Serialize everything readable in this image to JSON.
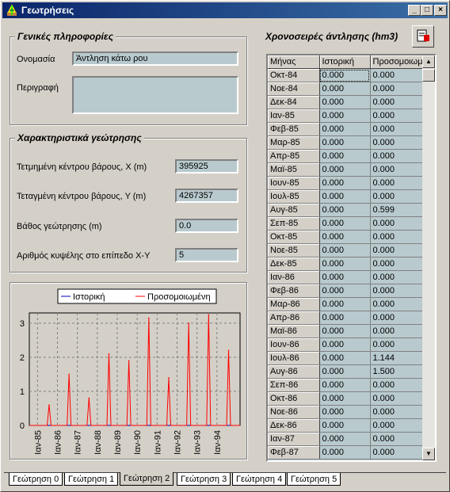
{
  "window": {
    "title": "Γεωτρήσεις",
    "minimize": "_",
    "maximize": "□",
    "close": "×"
  },
  "general": {
    "title": "Γενικές πληροφορίες",
    "name_label": "Ονομασία",
    "name_value": "Άντληση κάτω ρου",
    "description_label": "Περιγραφή",
    "description_value": ""
  },
  "characteristics": {
    "title": "Χαρακτηριστικά γεώτρησης",
    "x_label": "Τετμημένη κέντρου βάρους, X (m)",
    "x_value": "395925",
    "y_label": "Τεταγμένη κέντρου βάρους, Y (m)",
    "y_value": "4267357",
    "depth_label": "Βάθος γεώτρησης (m)",
    "depth_value": "0.0",
    "cell_label": "Αριθμός κυψέλης στο επίπεδο X-Y",
    "cell_value": "5"
  },
  "timeseries": {
    "title": "Χρονοσειρές άντλησης (hm3)",
    "columns": [
      "Μήνας",
      "Ιστορική",
      "Προσομοιωμ"
    ],
    "rows": [
      [
        "Οκτ-84",
        "0.000",
        "0.000"
      ],
      [
        "Νοε-84",
        "0.000",
        "0.000"
      ],
      [
        "Δεκ-84",
        "0.000",
        "0.000"
      ],
      [
        "Ιαν-85",
        "0.000",
        "0.000"
      ],
      [
        "Φεβ-85",
        "0.000",
        "0.000"
      ],
      [
        "Μαρ-85",
        "0.000",
        "0.000"
      ],
      [
        "Απρ-85",
        "0.000",
        "0.000"
      ],
      [
        "Μαϊ-85",
        "0.000",
        "0.000"
      ],
      [
        "Ιουν-85",
        "0.000",
        "0.000"
      ],
      [
        "Ιουλ-85",
        "0.000",
        "0.000"
      ],
      [
        "Αυγ-85",
        "0.000",
        "0.599"
      ],
      [
        "Σεπ-85",
        "0.000",
        "0.000"
      ],
      [
        "Οκτ-85",
        "0.000",
        "0.000"
      ],
      [
        "Νοε-85",
        "0.000",
        "0.000"
      ],
      [
        "Δεκ-85",
        "0.000",
        "0.000"
      ],
      [
        "Ιαν-86",
        "0.000",
        "0.000"
      ],
      [
        "Φεβ-86",
        "0.000",
        "0.000"
      ],
      [
        "Μαρ-86",
        "0.000",
        "0.000"
      ],
      [
        "Απρ-86",
        "0.000",
        "0.000"
      ],
      [
        "Μαϊ-86",
        "0.000",
        "0.000"
      ],
      [
        "Ιουν-86",
        "0.000",
        "0.000"
      ],
      [
        "Ιουλ-86",
        "0.000",
        "1.144"
      ],
      [
        "Αυγ-86",
        "0.000",
        "1.500"
      ],
      [
        "Σεπ-86",
        "0.000",
        "0.000"
      ],
      [
        "Οκτ-86",
        "0.000",
        "0.000"
      ],
      [
        "Νοε-86",
        "0.000",
        "0.000"
      ],
      [
        "Δεκ-86",
        "0.000",
        "0.000"
      ],
      [
        "Ιαν-87",
        "0.000",
        "0.000"
      ],
      [
        "Φεβ-87",
        "0.000",
        "0.000"
      ]
    ]
  },
  "chart_data": {
    "type": "line",
    "legend": [
      "Ιστορική",
      "Προσομοιωμένη"
    ],
    "legend_placement": "top",
    "colors": {
      "historic": "#0000c0",
      "simulated": "#ff0000"
    },
    "ylim": [
      0,
      3.3
    ],
    "yticks": [
      "0",
      "1",
      "2",
      "3"
    ],
    "xticks": [
      "Ιαν-85",
      "Ιαν-86",
      "Ιαν-87",
      "Ιαν-88",
      "Ιαν-89",
      "Ιαν-90",
      "Ιαν-91",
      "Ιαν-92",
      "Ιαν-93",
      "Ιαν-94"
    ],
    "grid": true,
    "series": [
      {
        "name": "Ιστορική",
        "values": [
          0,
          0,
          0,
          0,
          0,
          0,
          0,
          0,
          0,
          0
        ]
      },
      {
        "name": "Προσομοιωμένη",
        "peaks": [
          {
            "month": "Αυγ-85",
            "value": 0.6
          },
          {
            "month": "Αυγ-86",
            "value": 1.5
          },
          {
            "month": "Αυγ-87",
            "value": 0.8
          },
          {
            "month": "Αυγ-88",
            "value": 2.1
          },
          {
            "month": "Αυγ-89",
            "value": 1.9
          },
          {
            "month": "Αυγ-90",
            "value": 3.15
          },
          {
            "month": "Αυγ-91",
            "value": 1.4
          },
          {
            "month": "Αυγ-92",
            "value": 3.0
          },
          {
            "month": "Αυγ-93",
            "value": 3.25
          },
          {
            "month": "Αυγ-94",
            "value": 2.2
          }
        ]
      }
    ]
  },
  "tabs": [
    "Γεώτρηση 0",
    "Γεώτρηση 1",
    "Γεώτρηση 2",
    "Γεώτρηση 3",
    "Γεώτρηση 4",
    "Γεώτρηση 5"
  ],
  "active_tab": 2
}
